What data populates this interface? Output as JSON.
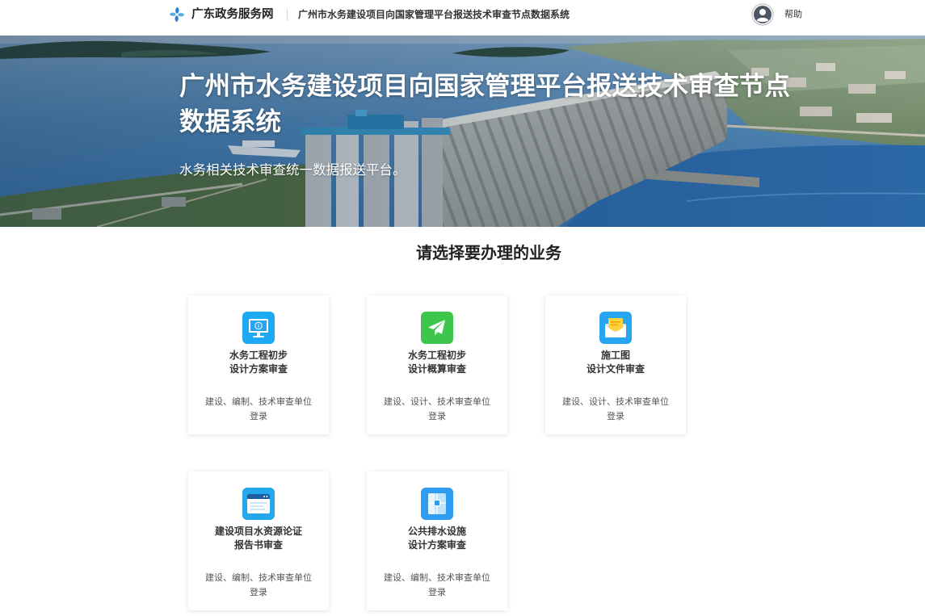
{
  "header": {
    "logo_text": "广东政务服务网",
    "system_name": "广州市水务建设项目向国家管理平台报送技术审查节点数据系统",
    "help_label": "帮助",
    "logo_icon": "pinwheel-logo-icon",
    "avatar_icon": "user-avatar-icon"
  },
  "hero": {
    "title": "广州市水务建设项目向国家管理平台报送技术审查节点数据系统",
    "subtitle": "水务相关技术审查统一数据报送平台。"
  },
  "services": {
    "heading": "请选择要办理的业务",
    "cards": [
      {
        "icon": "monitor-icon",
        "icon_color": "#1ea9f4",
        "title_lines": [
          "水务工程初步",
          "设计方案审查"
        ],
        "description": "建设、编制、技术审查单位登录"
      },
      {
        "icon": "paper-plane-icon",
        "icon_color": "#3ec64c",
        "title_lines": [
          "水务工程初步",
          "设计概算审查"
        ],
        "description": "建设、设计、技术审查单位登录"
      },
      {
        "icon": "envelope-icon",
        "icon_color": "#27a5ef",
        "title_lines": [
          "施工图",
          "设计文件审查"
        ],
        "description": "建设、设计、技术审查单位登录"
      },
      {
        "icon": "browser-window-icon",
        "icon_color": "#25a7ee",
        "title_lines": [
          "建设项目水资源论证",
          "报告书审查"
        ],
        "description": "建设、编制、技术审查单位登录"
      },
      {
        "icon": "folded-map-icon",
        "icon_color": "#2d9cf1",
        "title_lines": [
          "公共排水设施",
          "设计方案审查"
        ],
        "description": "建设、编制、技术审查单位登录"
      }
    ]
  },
  "colors": {
    "header_bg": "#ffffff",
    "brand_blue": "#2b7fd3",
    "text_primary": "#333333",
    "text_secondary": "#555555",
    "card_bg": "#ffffff"
  }
}
